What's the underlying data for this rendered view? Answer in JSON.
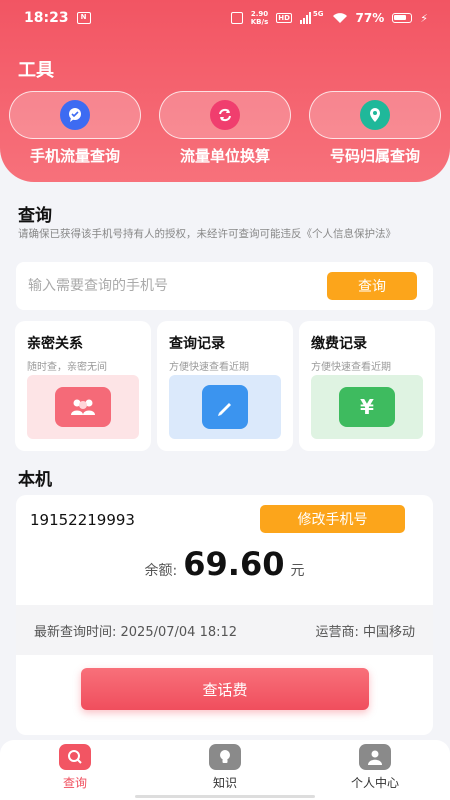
{
  "status_bar": {
    "time": "18:23",
    "note_badge": "N",
    "speed_top": "2.90",
    "speed_bottom": "KB/s",
    "hd": "HD",
    "network": "5G",
    "battery": "77%"
  },
  "tools": {
    "title": "工具",
    "items": [
      {
        "label": "手机流量查询",
        "icon": "chat-bubble-icon"
      },
      {
        "label": "流量单位换算",
        "icon": "refresh-icon"
      },
      {
        "label": "号码归属查询",
        "icon": "location-pin-icon"
      }
    ]
  },
  "query": {
    "title": "查询",
    "notice": "请确保已获得该手机号持有人的授权，未经许可查询可能违反《个人信息保护法》",
    "input_placeholder": "输入需要查询的手机号",
    "input_value": "",
    "button_label": "查询"
  },
  "features": [
    {
      "title": "亲密关系",
      "subtitle": "随时查，亲密无间"
    },
    {
      "title": "查询记录",
      "subtitle": "方便快速查看近期"
    },
    {
      "title": "缴费记录",
      "subtitle": "方便快速查看近期"
    }
  ],
  "device": {
    "title": "本机",
    "phone_number": "19152219993",
    "modify_label": "修改手机号",
    "balance_label": "余额:",
    "balance_value": "69.60",
    "balance_unit": "元",
    "last_query": "最新查询时间: 2025/07/04 18:12",
    "carrier": "运营商: 中国移动",
    "bill_button": "查话费"
  },
  "tabs": [
    {
      "label": "查询",
      "active": true
    },
    {
      "label": "知识",
      "active": false
    },
    {
      "label": "个人中心",
      "active": false
    }
  ],
  "colors": {
    "primary": "#f25563",
    "accent": "#fca51b",
    "tool_blue": "#3d6bf2",
    "tool_pink": "#f03e6e",
    "tool_teal": "#1fb89a"
  }
}
